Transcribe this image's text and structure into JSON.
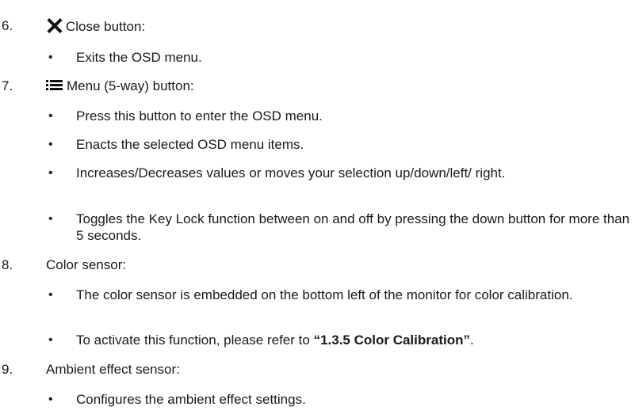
{
  "sections": [
    {
      "number": "6.",
      "icon": "close-x-icon",
      "title": "Close button:",
      "bullets": [
        "Exits the OSD menu."
      ]
    },
    {
      "number": "7.",
      "icon": "menu-list-icon",
      "title": "Menu (5-way) button:",
      "bullets": [
        "Press this button to enter the OSD menu.",
        "Enacts the selected OSD menu items.",
        "Increases/Decreases values or moves your selection up/down/left/ right.",
        "Toggles the Key Lock function between on and off by pressing the down button for more than 5 seconds."
      ]
    },
    {
      "number": "8.",
      "title": "Color sensor:",
      "bullets": [
        "The color sensor is embedded on the bottom left of the monitor for color calibration.",
        "To activate this function, please refer to "
      ],
      "bold_reference": "“1.3.5 Color Calibration”",
      "reference_suffix": "."
    },
    {
      "number": "9.",
      "title": "Ambient effect sensor:",
      "bullets": [
        "Configures the ambient effect settings."
      ]
    }
  ],
  "bullet_char": "•"
}
